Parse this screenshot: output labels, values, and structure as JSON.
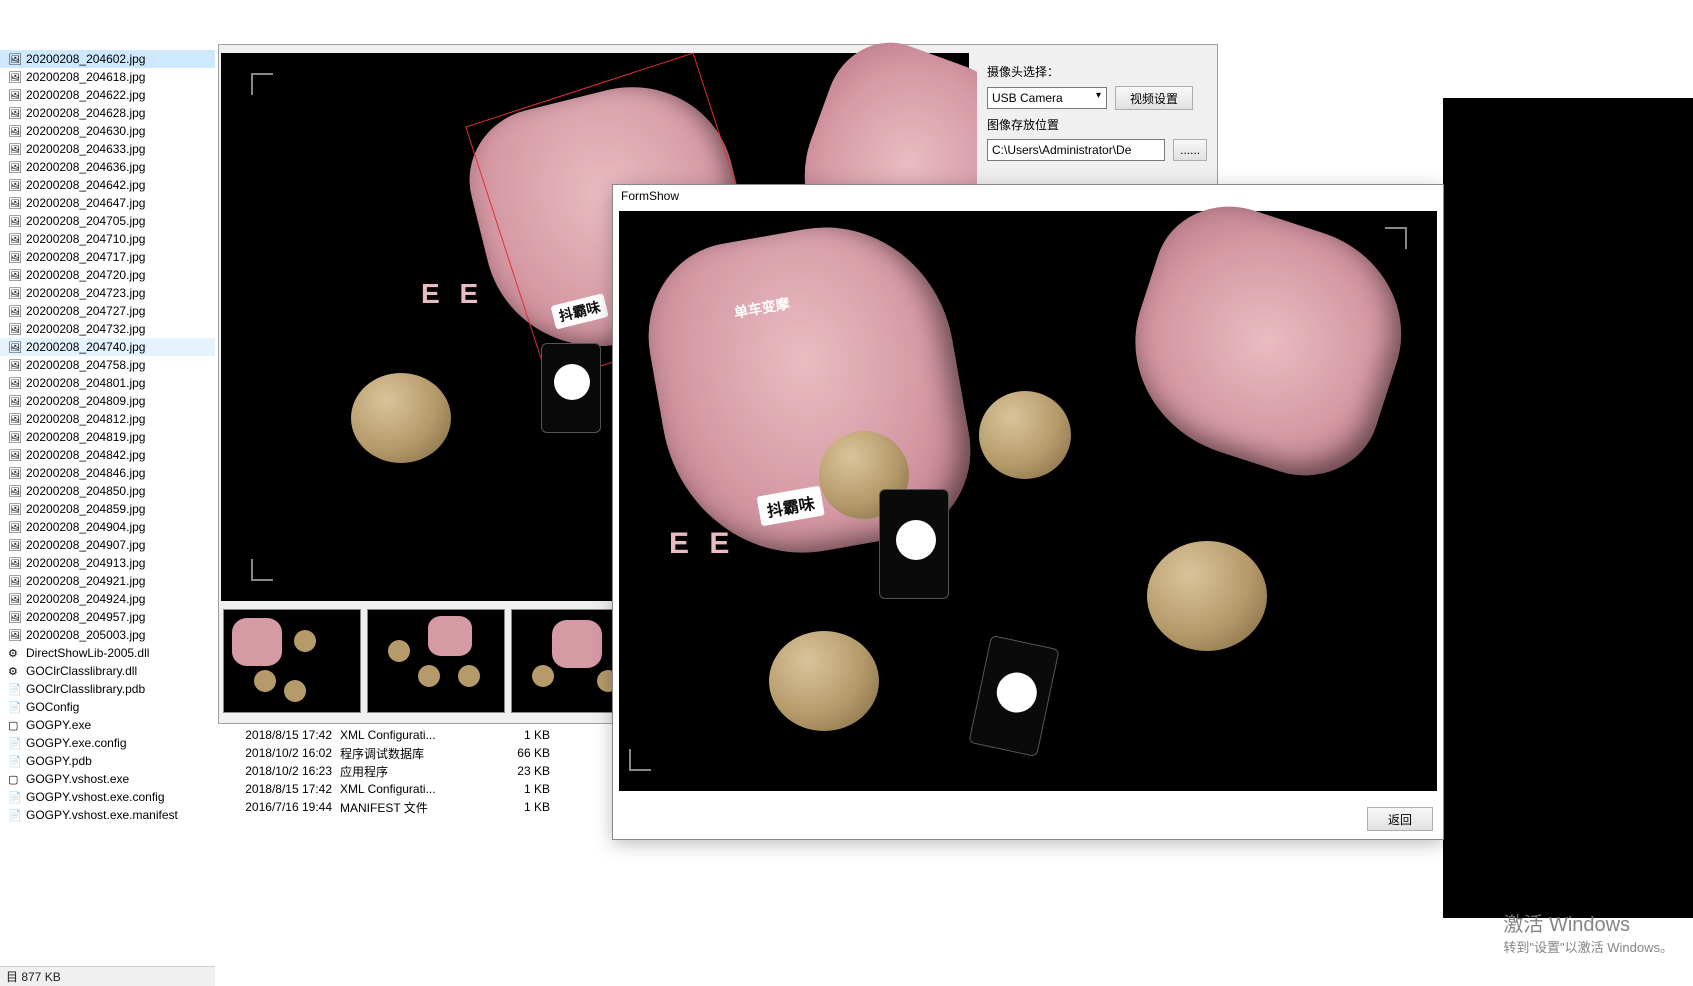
{
  "file_list": {
    "selected_index": 0,
    "highlighted_index": 16,
    "items": [
      {
        "name": "20200208_204602.jpg",
        "icon": "img"
      },
      {
        "name": "20200208_204618.jpg",
        "icon": "img"
      },
      {
        "name": "20200208_204622.jpg",
        "icon": "img"
      },
      {
        "name": "20200208_204628.jpg",
        "icon": "img"
      },
      {
        "name": "20200208_204630.jpg",
        "icon": "img"
      },
      {
        "name": "20200208_204633.jpg",
        "icon": "img"
      },
      {
        "name": "20200208_204636.jpg",
        "icon": "img"
      },
      {
        "name": "20200208_204642.jpg",
        "icon": "img"
      },
      {
        "name": "20200208_204647.jpg",
        "icon": "img"
      },
      {
        "name": "20200208_204705.jpg",
        "icon": "img"
      },
      {
        "name": "20200208_204710.jpg",
        "icon": "img"
      },
      {
        "name": "20200208_204717.jpg",
        "icon": "img"
      },
      {
        "name": "20200208_204720.jpg",
        "icon": "img"
      },
      {
        "name": "20200208_204723.jpg",
        "icon": "img"
      },
      {
        "name": "20200208_204727.jpg",
        "icon": "img"
      },
      {
        "name": "20200208_204732.jpg",
        "icon": "img"
      },
      {
        "name": "20200208_204740.jpg",
        "icon": "img"
      },
      {
        "name": "20200208_204758.jpg",
        "icon": "img"
      },
      {
        "name": "20200208_204801.jpg",
        "icon": "img"
      },
      {
        "name": "20200208_204809.jpg",
        "icon": "img"
      },
      {
        "name": "20200208_204812.jpg",
        "icon": "img"
      },
      {
        "name": "20200208_204819.jpg",
        "icon": "img"
      },
      {
        "name": "20200208_204842.jpg",
        "icon": "img"
      },
      {
        "name": "20200208_204846.jpg",
        "icon": "img"
      },
      {
        "name": "20200208_204850.jpg",
        "icon": "img"
      },
      {
        "name": "20200208_204859.jpg",
        "icon": "img"
      },
      {
        "name": "20200208_204904.jpg",
        "icon": "img"
      },
      {
        "name": "20200208_204907.jpg",
        "icon": "img"
      },
      {
        "name": "20200208_204913.jpg",
        "icon": "img"
      },
      {
        "name": "20200208_204921.jpg",
        "icon": "img"
      },
      {
        "name": "20200208_204924.jpg",
        "icon": "img"
      },
      {
        "name": "20200208_204957.jpg",
        "icon": "img"
      },
      {
        "name": "20200208_205003.jpg",
        "icon": "img"
      },
      {
        "name": "DirectShowLib-2005.dll",
        "icon": "dll"
      },
      {
        "name": "GOClrClasslibrary.dll",
        "icon": "dll"
      },
      {
        "name": "GOClrClasslibrary.pdb",
        "icon": "pdb"
      },
      {
        "name": "GOConfig",
        "icon": "cfg"
      },
      {
        "name": "GOGPY.exe",
        "icon": "exe"
      },
      {
        "name": "GOGPY.exe.config",
        "icon": "cfg"
      },
      {
        "name": "GOGPY.pdb",
        "icon": "pdb"
      },
      {
        "name": "GOGPY.vshost.exe",
        "icon": "exe"
      },
      {
        "name": "GOGPY.vshost.exe.config",
        "icon": "cfg"
      },
      {
        "name": "GOGPY.vshost.exe.manifest",
        "icon": "man"
      }
    ]
  },
  "status_bar": {
    "text": "目  877 KB"
  },
  "controls": {
    "camera_select_label": "摄像头选择：",
    "camera_options": [
      "USB Camera"
    ],
    "camera_selected": "USB Camera",
    "video_settings_label": "视频设置",
    "save_path_label": "图像存放位置",
    "save_path_value": "C:\\Users\\Administrator\\De",
    "browse_label": "......"
  },
  "details": {
    "rows": [
      {
        "date": "2018/8/15 17:42",
        "type": "XML Configurati...",
        "size": "1 KB"
      },
      {
        "date": "2018/10/2 16:02",
        "type": "程序调试数据库",
        "size": "66 KB"
      },
      {
        "date": "2018/10/2 16:23",
        "type": "应用程序",
        "size": "23 KB"
      },
      {
        "date": "2018/8/15 17:42",
        "type": "XML Configurati...",
        "size": "1 KB"
      },
      {
        "date": "2016/7/16 19:44",
        "type": "MANIFEST 文件",
        "size": "1 KB"
      }
    ]
  },
  "formshow": {
    "title": "FormShow",
    "return_label": "返回"
  },
  "watermark": {
    "line1": "激活 Windows",
    "line2": "转到\"设置\"以激活 Windows。"
  }
}
